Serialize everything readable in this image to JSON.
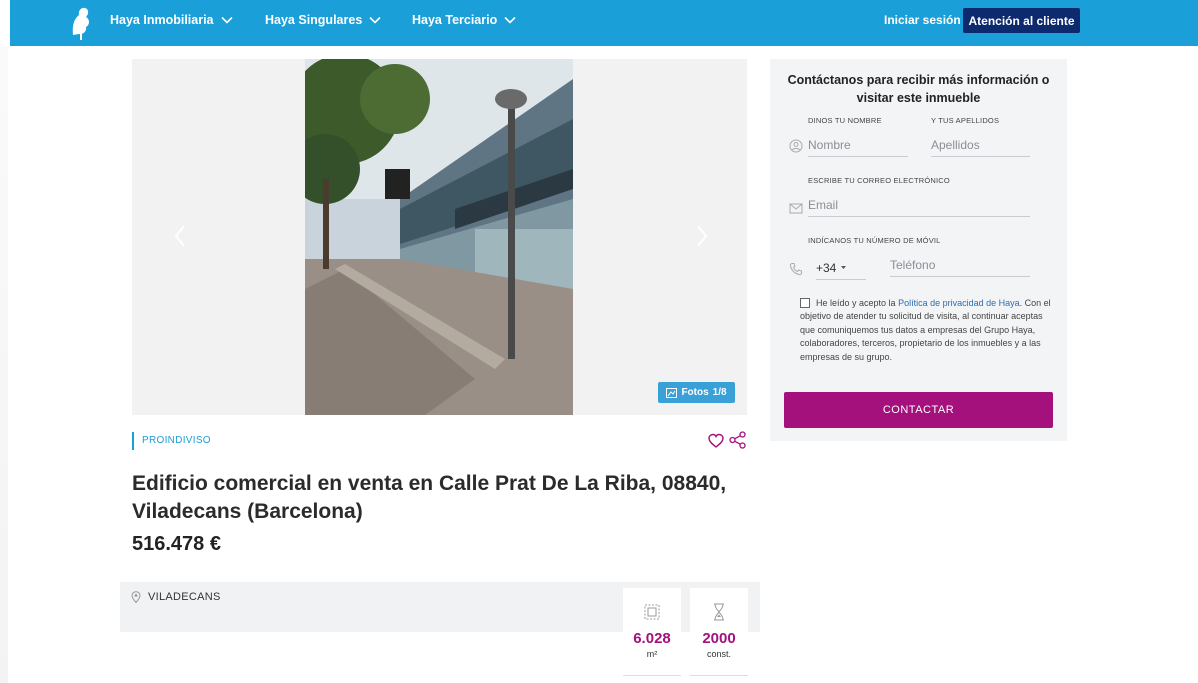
{
  "header": {
    "nav": [
      {
        "label": "Haya Inmobiliaria"
      },
      {
        "label": "Haya Singulares"
      },
      {
        "label": "Haya Terciario"
      }
    ],
    "login_label": "Iniciar sesión",
    "support_label": "Atención al cliente",
    "logo_text": "HAYA"
  },
  "gallery": {
    "badge_label": "Fotos",
    "badge_count": "1/8"
  },
  "listing": {
    "category": "PROINDIVISO",
    "title": "Edificio comercial en venta en Calle Prat De La Riba, 08840, Viladecans (Barcelona)",
    "price": "516.478 €",
    "location": "VILADECANS",
    "stats": [
      {
        "value": "6.028",
        "unit": "m²",
        "icon": "area-icon"
      },
      {
        "value": "2000",
        "unit": "const.",
        "icon": "hourglass-icon"
      }
    ]
  },
  "contact": {
    "title": "Contáctanos para recibir más información o visitar este inmueble",
    "name_label": "DINOS TU NOMBRE",
    "name_placeholder": "Nombre",
    "surname_label": "Y TUS APELLIDOS",
    "surname_placeholder": "Apellidos",
    "email_label": "ESCRIBE TU CORREO ELECTRÓNICO",
    "email_placeholder": "Email",
    "phone_label": "INDÍCANOS TU NÚMERO DE MÓVIL",
    "phone_prefix": "+34",
    "phone_placeholder": "Teléfono",
    "legal_pre": "He leído y acepto la ",
    "legal_link": "Política de privacidad de Haya",
    "legal_post": ". Con el objetivo de atender tu solicitud de visita, al continuar aceptas que comuniquemos tus datos a empresas del Grupo Haya, colaboradores, terceros, propietario de los inmuebles y a las empresas de su grupo.",
    "submit_label": "CONTACTAR"
  },
  "colors": {
    "header_blue": "#1a9fd9",
    "navy": "#0d2a6e",
    "accent_magenta": "#a4107c"
  }
}
